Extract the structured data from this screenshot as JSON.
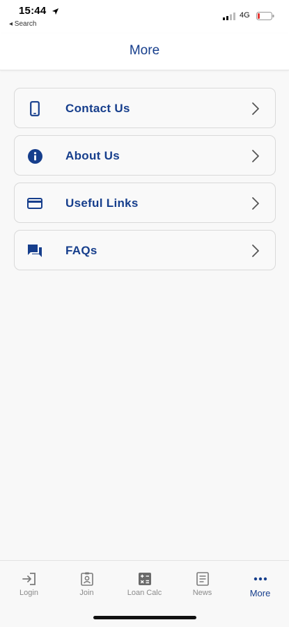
{
  "status_bar": {
    "time": "15:44",
    "back_label": "◂ Search",
    "network": "4G",
    "battery_color": "#e53935"
  },
  "header": {
    "title": "More"
  },
  "menu": {
    "items": [
      {
        "label": "Contact Us",
        "icon": "phone-icon"
      },
      {
        "label": "About Us",
        "icon": "info-icon"
      },
      {
        "label": "Useful Links",
        "icon": "card-icon"
      },
      {
        "label": "FAQs",
        "icon": "chat-icon"
      }
    ]
  },
  "tabs": [
    {
      "label": "Login",
      "icon": "login-icon",
      "active": false
    },
    {
      "label": "Join",
      "icon": "badge-icon",
      "active": false
    },
    {
      "label": "Loan Calc",
      "icon": "calculator-icon",
      "active": false
    },
    {
      "label": "News",
      "icon": "news-icon",
      "active": false
    },
    {
      "label": "More",
      "icon": "more-icon",
      "active": true
    }
  ],
  "colors": {
    "brand": "#163e8c",
    "tab_inactive": "#8a8a8a",
    "background": "#f8f8f8"
  }
}
